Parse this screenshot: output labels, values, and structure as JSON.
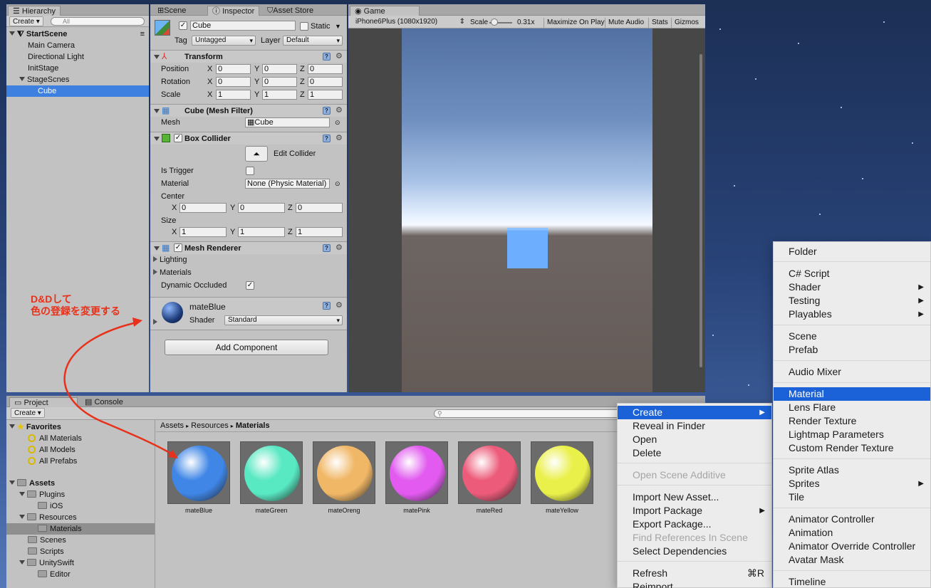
{
  "hierarchy": {
    "tab": "Hierarchy",
    "create": "Create",
    "search_placeholder": "All",
    "scene": "StartScene",
    "items": [
      "Main Camera",
      "Directional Light",
      "InitStage",
      "StageScnes",
      "Cube"
    ]
  },
  "tabs": {
    "scene": "Scene",
    "inspector": "Inspector",
    "asset_store": "Asset Store",
    "game": "Game"
  },
  "inspector": {
    "name": "Cube",
    "static": "Static",
    "tag_label": "Tag",
    "tag": "Untagged",
    "layer_label": "Layer",
    "layer": "Default",
    "transform": {
      "title": "Transform",
      "rows": [
        {
          "label": "Position",
          "x": "0",
          "y": "0",
          "z": "0"
        },
        {
          "label": "Rotation",
          "x": "0",
          "y": "0",
          "z": "0"
        },
        {
          "label": "Scale",
          "x": "1",
          "y": "1",
          "z": "1"
        }
      ]
    },
    "mesh_filter": {
      "title": "Cube (Mesh Filter)",
      "mesh_label": "Mesh",
      "mesh": "Cube"
    },
    "box_collider": {
      "title": "Box Collider",
      "edit": "Edit Collider",
      "is_trigger": "Is Trigger",
      "material_label": "Material",
      "material": "None (Physic Material)",
      "center": "Center",
      "center_x": "0",
      "center_y": "0",
      "center_z": "0",
      "size": "Size",
      "size_x": "1",
      "size_y": "1",
      "size_z": "1"
    },
    "mesh_renderer": {
      "title": "Mesh Renderer",
      "lighting": "Lighting",
      "materials": "Materials",
      "dynamic_occluded": "Dynamic Occluded"
    },
    "material": {
      "name": "mateBlue",
      "shader_label": "Shader",
      "shader": "Standard"
    },
    "add_component": "Add Component"
  },
  "axis": {
    "x": "X",
    "y": "Y",
    "z": "Z"
  },
  "game": {
    "resolution": "iPhone6Plus (1080x1920)",
    "scale_label": "Scale",
    "scale": "0.31x",
    "maximize": "Maximize On Play",
    "mute": "Mute Audio",
    "stats": "Stats",
    "gizmos": "Gizmos"
  },
  "annotation": {
    "line1": "D&Dして",
    "line2": "色の登録を変更する",
    "color": "#e8311a"
  },
  "project": {
    "tab": "Project",
    "console": "Console",
    "create": "Create",
    "favorites": "Favorites",
    "fav_items": [
      "All Materials",
      "All Models",
      "All Prefabs"
    ],
    "assets": "Assets",
    "plugins": "Plugins",
    "ios": "iOS",
    "resources": "Resources",
    "materials": "Materials",
    "scenes": "Scenes",
    "scripts": "Scripts",
    "unityswift": "UnitySwift",
    "editor": "Editor",
    "breadcrumb": [
      "Assets",
      "Resources",
      "Materials"
    ],
    "thumbs": [
      {
        "name": "mateBlue",
        "color": "#3f86e6"
      },
      {
        "name": "mateGreen",
        "color": "#58e8c2"
      },
      {
        "name": "mateOreng",
        "color": "#f0b766"
      },
      {
        "name": "matePink",
        "color": "#e25af0"
      },
      {
        "name": "mateRed",
        "color": "#ec5b7a"
      },
      {
        "name": "mateYellow",
        "color": "#eaf04a"
      }
    ]
  },
  "context_menu": {
    "items": [
      "Create",
      "Reveal in Finder",
      "Open",
      "Delete",
      "Open Scene Additive",
      "Import New Asset...",
      "Import Package",
      "Export Package...",
      "Find References In Scene",
      "Select Dependencies",
      "Refresh",
      "Reimport"
    ],
    "refresh_shortcut": "⌘R"
  },
  "submenu": {
    "items": [
      "Folder",
      "C# Script",
      "Shader",
      "Testing",
      "Playables",
      "Scene",
      "Prefab",
      "Audio Mixer",
      "Material",
      "Lens Flare",
      "Render Texture",
      "Lightmap Parameters",
      "Custom Render Texture",
      "Sprite Atlas",
      "Sprites",
      "Tile",
      "Animator Controller",
      "Animation",
      "Animator Override Controller",
      "Avatar Mask",
      "Timeline"
    ]
  }
}
